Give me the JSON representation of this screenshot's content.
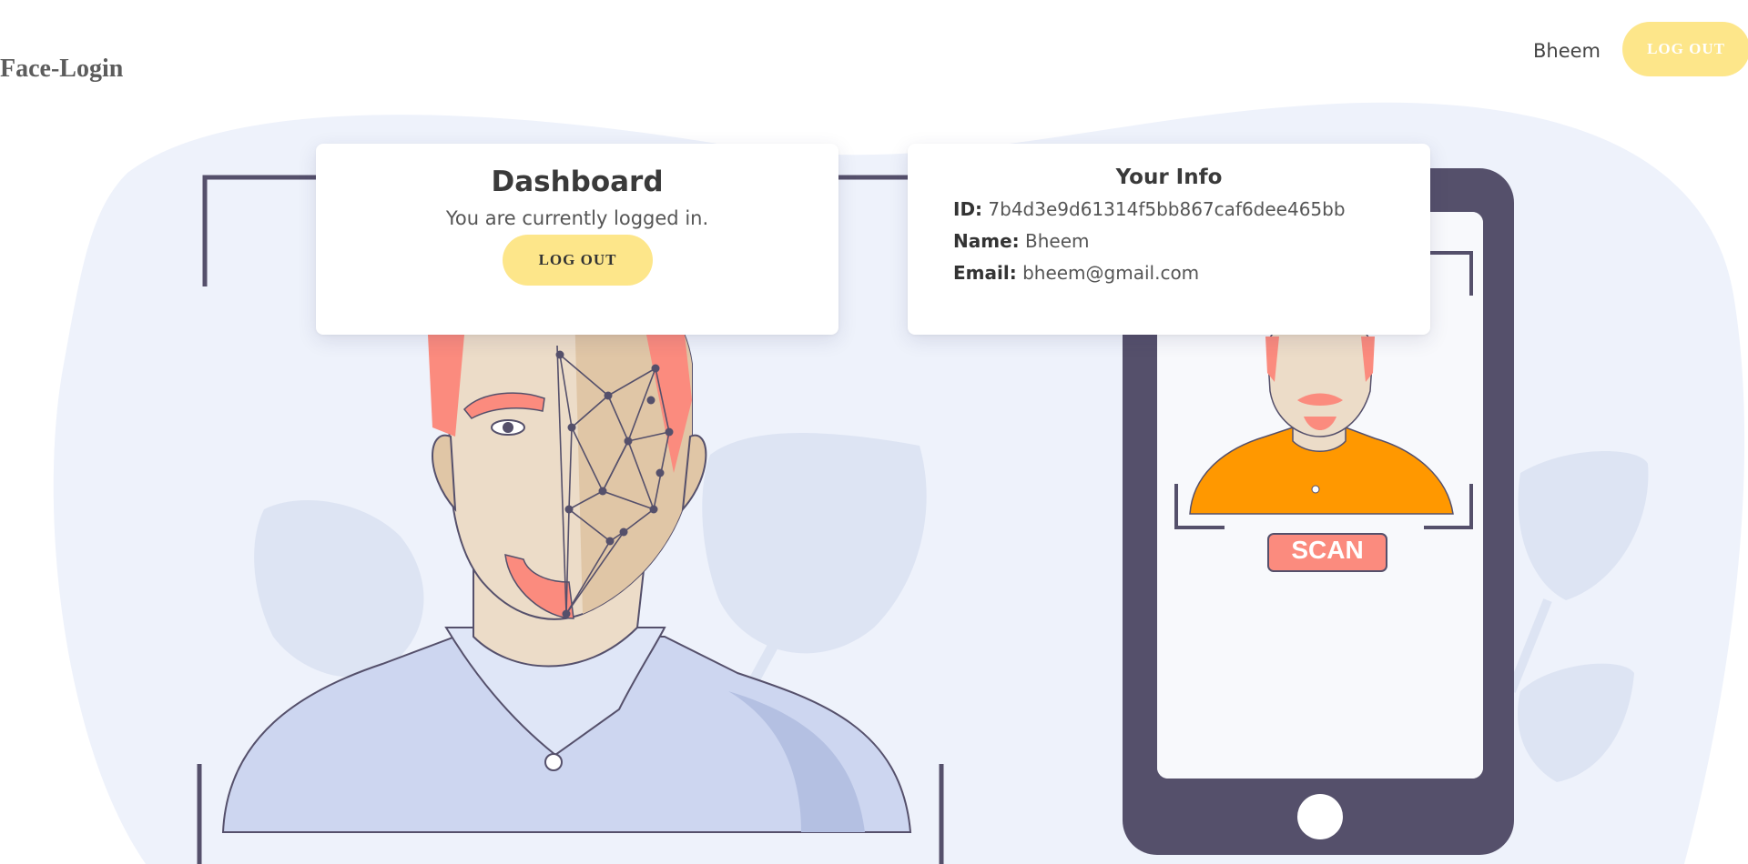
{
  "header": {
    "brand": "Face-Login",
    "user_name": "Bheem",
    "logout_label": "LOG OUT"
  },
  "dashboard": {
    "title": "Dashboard",
    "status_text": "You are currently logged in.",
    "logout_label": "LOG OUT"
  },
  "info": {
    "title": "Your Info",
    "id_label": "ID:",
    "id_value": "7b4d3e9d61314f5bb867caf6dee465bb",
    "name_label": "Name:",
    "name_value": "Bheem",
    "email_label": "Email:",
    "email_value": "bheem@gmail.com"
  },
  "illustration": {
    "scan_label": "SCAN"
  },
  "colors": {
    "accent_yellow": "#fde68a",
    "blob_bg": "#eef2fb",
    "frame_dark": "#55506b",
    "scan_red": "#fb8b7e",
    "shirt_orange": "#ff9800",
    "shirt_blue": "#cdd6f0"
  }
}
